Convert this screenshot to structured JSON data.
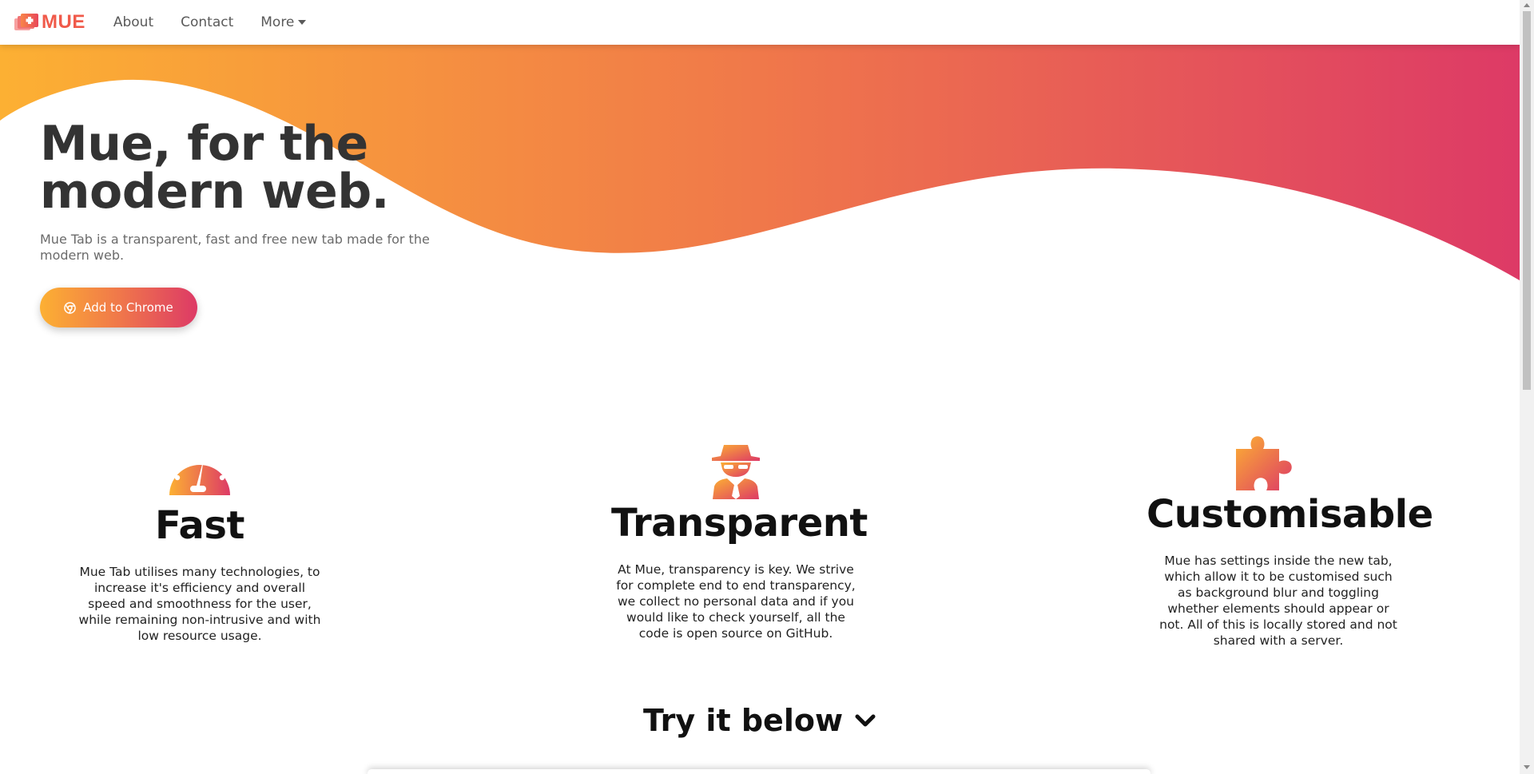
{
  "brand": {
    "name": "MUE",
    "icon": "mue-logo-icon"
  },
  "nav": {
    "links": [
      {
        "label": "About"
      },
      {
        "label": "Contact"
      },
      {
        "label": "More",
        "icon": "caret-down-icon"
      }
    ]
  },
  "hero": {
    "title_line1": "Mue, for the",
    "title_line2": "modern web.",
    "subtitle": "Mue Tab is a transparent, fast and free new tab made for the modern web.",
    "cta_label": "Add to Chrome",
    "cta_icon": "chrome-icon"
  },
  "features": [
    {
      "icon": "speedometer-icon",
      "title": "Fast",
      "description": "Mue Tab utilises many technologies, to increase it's efficiency and overall speed and smoothness for the user, while remaining non-intrusive and with low resource usage."
    },
    {
      "icon": "spy-icon",
      "title": "Transparent",
      "description": "At Mue, transparency is key. We strive for complete end to end transparency, we collect no personal data and if you would like to check yourself, all the code is open source on GitHub."
    },
    {
      "icon": "puzzle-icon",
      "title": "Customisable",
      "description": "Mue has settings inside the new tab, which allow it to be customised such as background blur and toggling whether elements should appear or not. All of this is locally stored and not shared with a server."
    }
  ],
  "try_section": {
    "label": "Try it below",
    "icon": "chevron-down-icon"
  },
  "colors": {
    "gradient_start": "#fcb033",
    "gradient_mid": "#f0784a",
    "gradient_end": "#dd3a66",
    "brand": "#f05a4a"
  }
}
